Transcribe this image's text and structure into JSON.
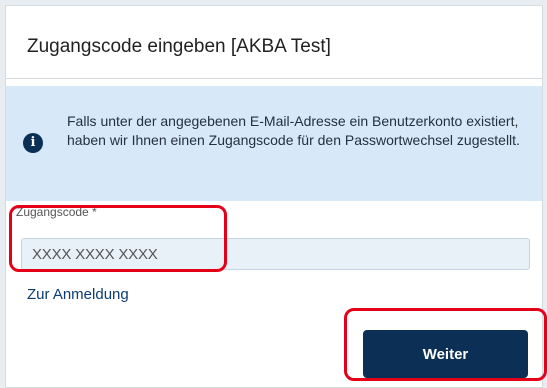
{
  "dialog": {
    "title": "Zugangscode eingeben [AKBA Test]"
  },
  "info": {
    "icon": "info-icon",
    "icon_glyph": "i",
    "message": "Falls unter der angegebenen E-Mail-Adresse ein Benutzerkonto existiert, haben wir Ihnen einen Zugangscode für den Passwortwechsel zugestellt."
  },
  "form": {
    "code_label": "Zugangscode *",
    "code_value": "",
    "code_placeholder": "XXXX XXXX XXXX",
    "login_link": "Zur Anmeldung",
    "submit_label": "Weiter"
  },
  "colors": {
    "accent": "#0b2f55",
    "banner_background": "#d7e8f8",
    "highlight": "#e5001a"
  }
}
